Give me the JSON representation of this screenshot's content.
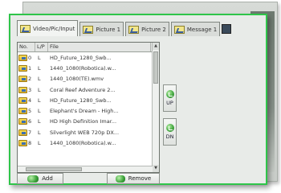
{
  "tabs": [
    {
      "label": "Video/Pic/Input",
      "active": true
    },
    {
      "label": "Picture 1",
      "active": false
    },
    {
      "label": "Picture 2",
      "active": false
    },
    {
      "label": "Message 1",
      "active": false
    }
  ],
  "list": {
    "columns": [
      "No.",
      "L/P",
      "File"
    ],
    "rows": [
      {
        "no": "0",
        "lp": "L",
        "file": "HD_Future_1280_Swb..."
      },
      {
        "no": "1",
        "lp": "L",
        "file": "1440_1080(Robotica).w..."
      },
      {
        "no": "2",
        "lp": "L",
        "file": "1440_1080(TE).wmv"
      },
      {
        "no": "3",
        "lp": "L",
        "file": "Coral Reef Adventure 2..."
      },
      {
        "no": "4",
        "lp": "L",
        "file": "HD_Future_1280_Swb..."
      },
      {
        "no": "5",
        "lp": "L",
        "file": "Elephant's Dream - High..."
      },
      {
        "no": "6",
        "lp": "L",
        "file": "HD High Definition Imar..."
      },
      {
        "no": "7",
        "lp": "L",
        "file": "Silverlight WEB 720p DX..."
      },
      {
        "no": "8",
        "lp": "L",
        "file": "1440_1080(Robotica).w..."
      }
    ]
  },
  "side": {
    "up_label": "UP",
    "dn_label": "DN"
  },
  "buttons": {
    "add_label": "Add",
    "remove_label": "Remove"
  },
  "colors": {
    "frame_border": "#2fc54a",
    "panel_bg": "#e8ebe8"
  }
}
